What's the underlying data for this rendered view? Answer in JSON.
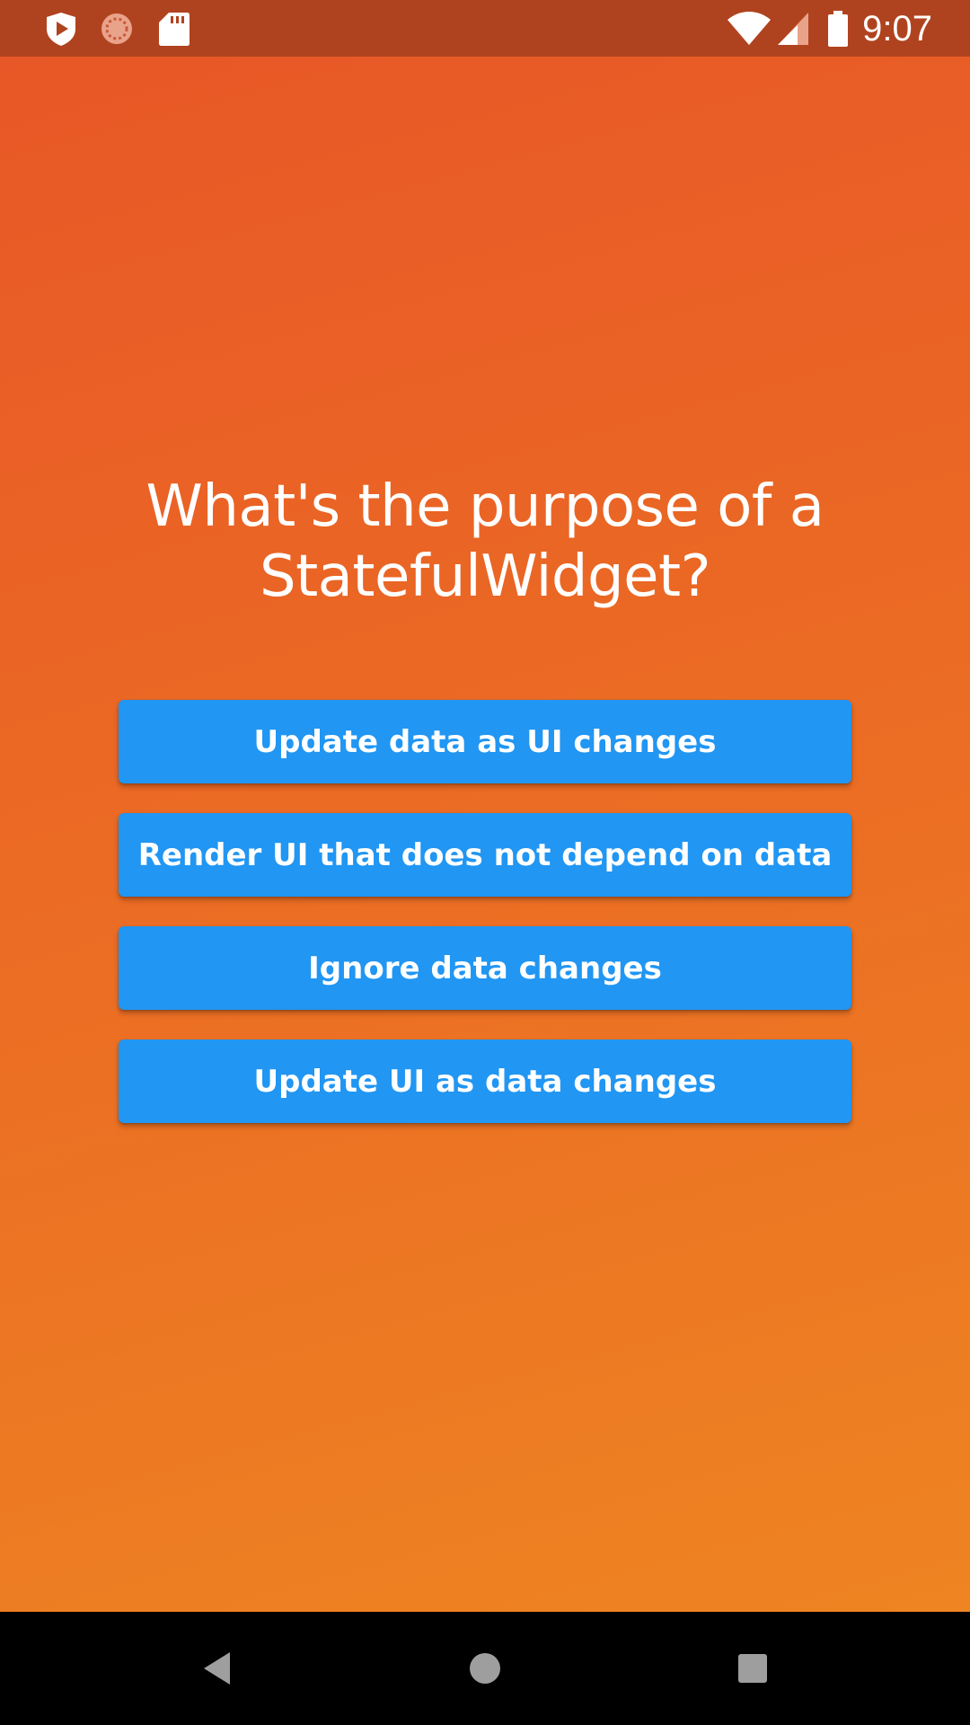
{
  "status_bar": {
    "time": "9:07",
    "left_icons": [
      "shield-play-icon",
      "loading-circle-icon",
      "sd-card-icon"
    ],
    "right_icons": [
      "wifi-icon",
      "cell-signal-icon",
      "battery-icon"
    ]
  },
  "quiz": {
    "question": "What's the purpose of a StatefulWidget?",
    "answers": [
      "Update data as UI changes",
      "Render UI that does not depend on data",
      "Ignore data changes",
      "Update UI as data changes"
    ]
  },
  "nav_bar": {
    "buttons": [
      "back-icon",
      "home-icon",
      "recents-icon"
    ]
  },
  "colors": {
    "background_gradient_start": "#e85727",
    "background_gradient_end": "#ee8422",
    "status_bar": "#b0431f",
    "button": "#2196f3",
    "text": "#ffffff",
    "nav_bar": "#000000"
  }
}
